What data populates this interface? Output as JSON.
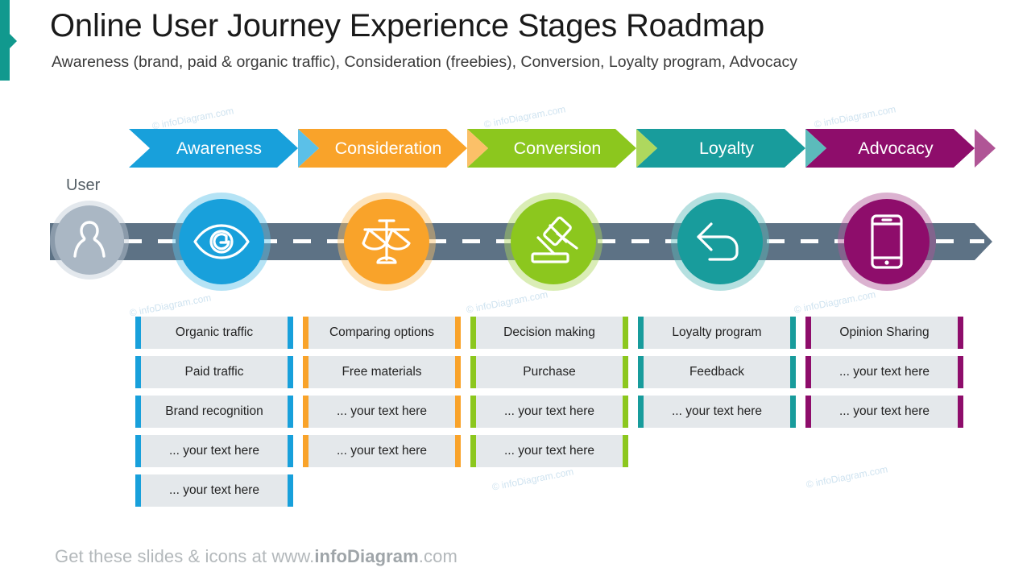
{
  "title": "Online User Journey Experience Stages Roadmap",
  "subtitle": "Awareness (brand, paid & organic traffic), Consideration (freebies), Conversion, Loyalty program, Advocacy",
  "user_label": "User",
  "footer": {
    "prefix": "Get these slides & icons at www.",
    "brand": "infoDiagram",
    "suffix": ".com"
  },
  "watermark": "© infoDiagram.com",
  "colors": {
    "awareness": "#18a0db",
    "awareness_light": "#5bc0e8",
    "consideration": "#f9a32a",
    "consideration_light": "#fbc068",
    "conversion": "#8cc71e",
    "conversion_light": "#aed85e",
    "loyalty": "#189c9c",
    "loyalty_light": "#5cbbbb",
    "advocacy": "#8e0d6b",
    "advocacy_light": "#b05596",
    "road": "#5d7285",
    "user_circle": "#aab7c4",
    "user_halo": "#c2ccd6",
    "cell_bg": "#e4e8eb",
    "accent": "#11998e"
  },
  "stages": [
    {
      "id": "awareness",
      "label": "Awareness",
      "icon": "eye-icon",
      "color": "#18a0db",
      "color_light": "#5bc0e8",
      "items": [
        "Organic traffic",
        "Paid traffic",
        "Brand recognition",
        "... your text here",
        "... your text here"
      ]
    },
    {
      "id": "consideration",
      "label": "Consideration",
      "icon": "balance-scales-icon",
      "color": "#f9a32a",
      "color_light": "#fbc068",
      "items": [
        "Comparing options",
        "Free materials",
        "... your text here",
        "... your text here"
      ]
    },
    {
      "id": "conversion",
      "label": "Conversion",
      "icon": "gavel-icon",
      "color": "#8cc71e",
      "color_light": "#aed85e",
      "items": [
        "Decision making",
        "Purchase",
        "... your text here",
        "... your text here"
      ]
    },
    {
      "id": "loyalty",
      "label": "Loyalty",
      "icon": "return-arrow-icon",
      "color": "#189c9c",
      "color_light": "#5cbbbb",
      "items": [
        "Loyalty program",
        "Feedback",
        "... your text here"
      ]
    },
    {
      "id": "advocacy",
      "label": "Advocacy",
      "icon": "smartphone-icon",
      "color": "#8e0d6b",
      "color_light": "#b05596",
      "items": [
        "Opinion Sharing",
        "... your text here",
        "... your text here"
      ]
    }
  ]
}
